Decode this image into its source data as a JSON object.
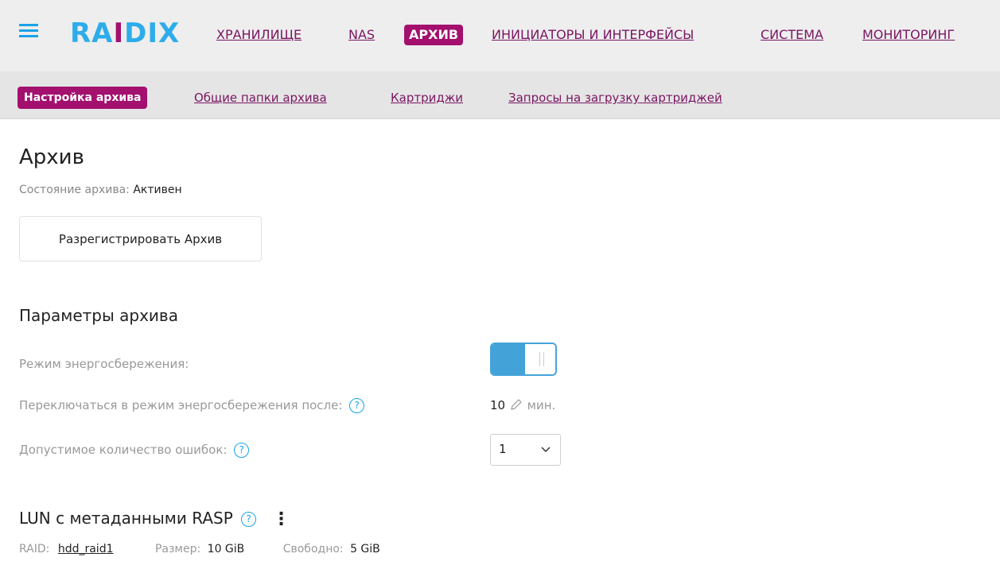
{
  "header": {
    "logo_text": "RAIDIX",
    "nav": [
      {
        "label": "ХРАНИЛИЩЕ",
        "active": false
      },
      {
        "label": "NAS",
        "active": false
      },
      {
        "label": "АРХИВ",
        "active": true
      },
      {
        "label": "ИНИЦИАТОРЫ И ИНТЕРФЕЙСЫ",
        "active": false
      },
      {
        "label": "СИСТЕМА",
        "active": false
      },
      {
        "label": "МОНИТОРИНГ",
        "active": false
      }
    ]
  },
  "subnav": [
    {
      "label": "Настройка архива",
      "active": true
    },
    {
      "label": "Общие папки архива",
      "active": false
    },
    {
      "label": "Картриджи",
      "active": false
    },
    {
      "label": "Запросы на загрузку картриджей",
      "active": false
    }
  ],
  "page": {
    "title": "Архив",
    "status_label": "Состояние архива:",
    "status_value": "Активен",
    "unregister_button": "Разрегистрировать Архив"
  },
  "params": {
    "title": "Параметры архива",
    "power_saving_label": "Режим энергосбережения:",
    "power_saving_enabled": true,
    "switch_after_label": "Переключаться в режим энергосбережения после:",
    "switch_after_value": "10",
    "switch_after_unit": "мин.",
    "errors_label": "Допустимое количество ошибок:",
    "errors_value": "1"
  },
  "lun": {
    "title": "LUN с метаданными RASP",
    "raid_label": "RAID:",
    "raid_value": "hdd_raid1",
    "size_label": "Размер:",
    "size_value": "10 GiB",
    "free_label": "Свободно:",
    "free_value": "5 GiB"
  },
  "icons": {
    "help": "question-circle-icon",
    "edit": "pencil-icon",
    "more": "kebab-menu-icon",
    "menu": "hamburger-icon"
  },
  "colors": {
    "brand_blue": "#2dacea",
    "brand_magenta": "#a3106e",
    "link": "#7a1562",
    "toggle_on": "#43a3d9"
  }
}
